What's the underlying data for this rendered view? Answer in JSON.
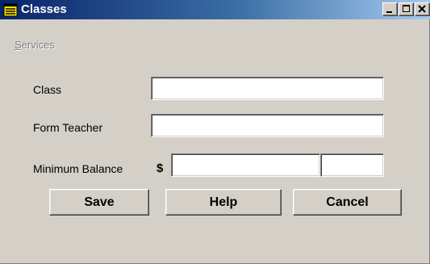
{
  "window": {
    "title": "Classes",
    "icon": "notepad-icon",
    "controls": {
      "minimize": "minimize-icon",
      "maximize": "maximize-icon",
      "close": "close-icon"
    }
  },
  "menu": {
    "services_accel": "S",
    "services_rest": "ervices"
  },
  "form": {
    "class_label": "Class",
    "class_value": "",
    "form_teacher_label": "Form Teacher",
    "form_teacher_value": "",
    "min_balance_label": "Minimum Balance",
    "currency_symbol": "$",
    "min_balance_dollars": "",
    "min_balance_cents": ""
  },
  "buttons": {
    "save": "Save",
    "help": "Help",
    "cancel": "Cancel"
  },
  "colors": {
    "title_gradient_start": "#0a246a",
    "title_gradient_end": "#a6caf0",
    "face": "#d4d0c8",
    "disabled_text": "#808080"
  }
}
